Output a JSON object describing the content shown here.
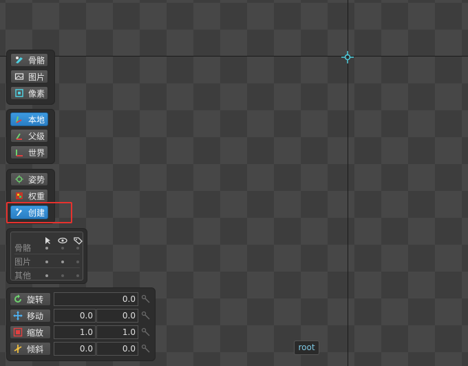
{
  "tool_groups": {
    "modes": [
      {
        "label": "骨骼",
        "icon": "bone-icon",
        "active": false
      },
      {
        "label": "图片",
        "icon": "image-icon",
        "active": false
      },
      {
        "label": "像素",
        "icon": "pixel-icon",
        "active": false
      }
    ],
    "axes": [
      {
        "label": "本地",
        "icon": "local-axis-icon",
        "active": true
      },
      {
        "label": "父级",
        "icon": "parent-axis-icon",
        "active": false
      },
      {
        "label": "世界",
        "icon": "world-axis-icon",
        "active": false
      }
    ],
    "tools": [
      {
        "label": "姿势",
        "icon": "pose-icon",
        "active": false
      },
      {
        "label": "权重",
        "icon": "weights-icon",
        "active": false
      },
      {
        "label": "创建",
        "icon": "create-icon",
        "active": true
      }
    ]
  },
  "visibility": {
    "rows": [
      {
        "label": "骨骼"
      },
      {
        "label": "图片"
      },
      {
        "label": "其他"
      }
    ]
  },
  "transform": {
    "rotate": {
      "label": "旋转",
      "value": "0.0"
    },
    "translate": {
      "label": "移动",
      "x": "0.0",
      "y": "0.0"
    },
    "scale": {
      "label": "缩放",
      "x": "1.0",
      "y": "1.0"
    },
    "shear": {
      "label": "倾斜",
      "x": "0.0",
      "y": "0.0"
    }
  },
  "viewport": {
    "selected_bone": "root"
  },
  "colors": {
    "accent": "#2a7ec4",
    "highlight": "#e8322e",
    "bone_cyan": "#4fd0e0"
  }
}
